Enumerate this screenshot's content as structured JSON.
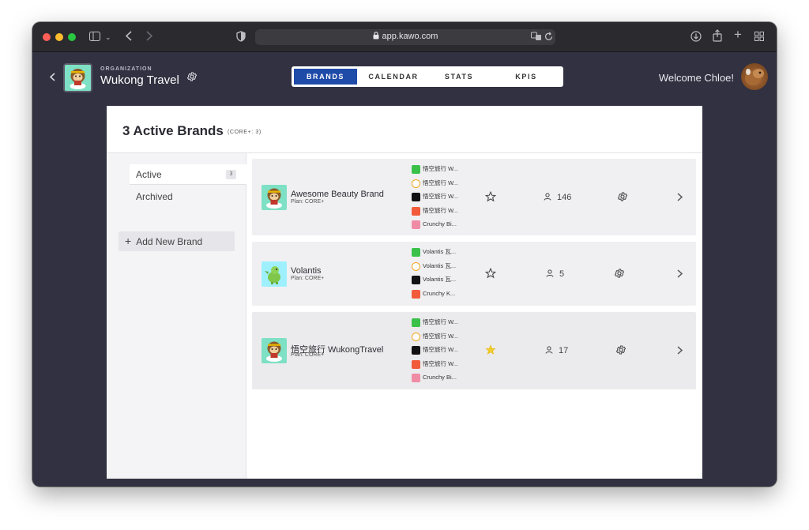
{
  "browser": {
    "url": "app.kawo.com"
  },
  "header": {
    "org_caption": "ORGANIZATION",
    "org_name": "Wukong Travel",
    "tabs": [
      {
        "label": "BRANDS",
        "active": true
      },
      {
        "label": "CALENDAR",
        "active": false
      },
      {
        "label": "STATS",
        "active": false
      },
      {
        "label": "KPIS",
        "active": false
      }
    ],
    "welcome": "Welcome Chloe!"
  },
  "panel": {
    "title": "3 Active Brands",
    "subtitle": "(CORE+: 3)"
  },
  "sidebar": {
    "items": [
      {
        "label": "Active",
        "count": "3",
        "active": true
      },
      {
        "label": "Archived",
        "active": false
      }
    ],
    "add_button": "Add New Brand"
  },
  "brands": [
    {
      "name": "Awesome Beauty Brand",
      "plan": "Plan: CORE+",
      "starred": false,
      "users": "146",
      "channels": [
        {
          "platform": "wechat",
          "color": "#3bc14a",
          "label": "悟空旅行 W..."
        },
        {
          "platform": "weibo",
          "color": "#f5a623",
          "label": "悟空旅行 W..."
        },
        {
          "platform": "douyin",
          "color": "#111111",
          "label": "悟空旅行 W..."
        },
        {
          "platform": "xiaohongshu",
          "color": "#f25a3c",
          "label": "悟空旅行 W..."
        },
        {
          "platform": "bilibili",
          "color": "#f08ba6",
          "label": "Crunchy Bi..."
        }
      ]
    },
    {
      "name": "Volantis",
      "plan": "Plan: CORE+",
      "starred": false,
      "users": "5",
      "channels": [
        {
          "platform": "wechat",
          "color": "#3bc14a",
          "label": "Volantis 瓦..."
        },
        {
          "platform": "weibo",
          "color": "#f5a623",
          "label": "Volantis 瓦..."
        },
        {
          "platform": "douyin",
          "color": "#111111",
          "label": "Volantis 瓦..."
        },
        {
          "platform": "xiaohongshu",
          "color": "#f25a3c",
          "label": "Crunchy K..."
        }
      ]
    },
    {
      "name": "悟空旅行 WukongTravel",
      "plan": "Plan: CORE+",
      "starred": true,
      "users": "17",
      "channels": [
        {
          "platform": "wechat",
          "color": "#3bc14a",
          "label": "悟空旅行 W..."
        },
        {
          "platform": "weibo",
          "color": "#f5a623",
          "label": "悟空旅行 W..."
        },
        {
          "platform": "douyin",
          "color": "#111111",
          "label": "悟空旅行 W..."
        },
        {
          "platform": "xiaohongshu",
          "color": "#f25a3c",
          "label": "悟空旅行 W..."
        },
        {
          "platform": "bilibili",
          "color": "#f08ba6",
          "label": "Crunchy Bi..."
        }
      ]
    }
  ],
  "colors": {
    "app_bg": "#313141",
    "accent": "#1f4ba8",
    "star_active": "#f2cc2b"
  }
}
